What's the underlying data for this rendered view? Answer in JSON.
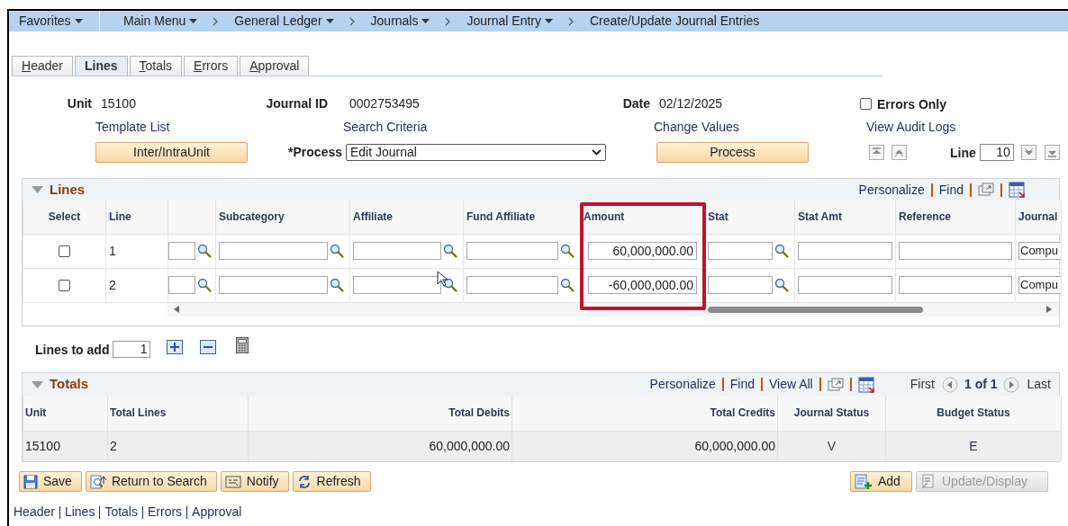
{
  "nav": [
    {
      "label": "Favorites",
      "kind": "menu",
      "dropdown": true
    },
    {
      "label": "Main Menu",
      "kind": "menu",
      "dropdown": true
    },
    {
      "label": "General Ledger",
      "kind": "crumb",
      "dropdown": true
    },
    {
      "label": "Journals",
      "kind": "crumb",
      "dropdown": true
    },
    {
      "label": "Journal Entry",
      "kind": "crumb",
      "dropdown": true
    },
    {
      "label": "Create/Update Journal Entries",
      "kind": "crumb",
      "dropdown": false
    }
  ],
  "tabs": [
    {
      "label": "Header",
      "selected": false
    },
    {
      "label": "Lines",
      "selected": true
    },
    {
      "label": "Totals",
      "selected": false
    },
    {
      "label": "Errors",
      "selected": false
    },
    {
      "label": "Approval",
      "selected": false
    }
  ],
  "header": {
    "unit_label": "Unit",
    "unit": "15100",
    "journal_id_label": "Journal ID",
    "journal_id": "0002753495",
    "date_label": "Date",
    "date": "02/12/2025",
    "errors_only": {
      "label": "Errors Only",
      "checked": false
    },
    "links": [
      "Template List",
      "Search Criteria",
      "Change Values",
      "View Audit Logs"
    ],
    "inter_button": "Inter/IntraUnit",
    "process_label": "*Process",
    "process_value": "Edit Journal",
    "process_button": "Process",
    "line_label": "Line",
    "line_value": "10"
  },
  "lines": {
    "title": "Lines",
    "toolbar": [
      "Personalize",
      "Find"
    ],
    "columns": [
      {
        "label": "Select",
        "kind": "select",
        "highlighted": false
      },
      {
        "label": "Line",
        "kind": "line",
        "highlighted": false
      },
      {
        "kind": "lookup",
        "highlighted": false
      },
      {
        "label": "Subcategory",
        "kind": "lookup",
        "highlighted": false
      },
      {
        "label": "Affiliate",
        "kind": "lookup",
        "highlighted": false
      },
      {
        "label": "Fund Affiliate",
        "kind": "lookup",
        "highlighted": false
      },
      {
        "label": "Amount",
        "kind": "amount",
        "highlighted": true
      },
      {
        "label": "Stat",
        "kind": "lookup",
        "highlighted": false
      },
      {
        "label": "Stat Amt",
        "kind": "input",
        "highlighted": false
      },
      {
        "label": "Reference",
        "kind": "input",
        "highlighted": false
      },
      {
        "label": "Journal",
        "kind": "journal",
        "highlighted": false
      }
    ],
    "rows": [
      {
        "selected": false,
        "line": "1",
        "amount": "60,000,000.00",
        "journal": "Compu"
      },
      {
        "selected": false,
        "line": "2",
        "amount": "-60,000,000.00",
        "journal": "Compu"
      }
    ]
  },
  "lines_to_add": {
    "label": "Lines to add",
    "value": "1"
  },
  "totals": {
    "title": "Totals",
    "toolbar": [
      "Personalize",
      "Find",
      "View All"
    ],
    "pager": {
      "first": "First",
      "range": "1 of 1",
      "last": "Last"
    },
    "columns": [
      "Unit",
      "Total Lines",
      "Total Debits",
      "Total Credits",
      "Journal Status",
      "Budget Status"
    ],
    "rows": [
      [
        "15100",
        "2",
        "60,000,000.00",
        "60,000,000.00",
        "V",
        "E"
      ]
    ]
  },
  "buttons": [
    {
      "label": "Save",
      "kind": "save",
      "disabled": false
    },
    {
      "label": "Return to Search",
      "kind": "return",
      "disabled": false
    },
    {
      "label": "Notify",
      "kind": "notify",
      "disabled": false
    },
    {
      "label": "Refresh",
      "kind": "refresh",
      "disabled": false
    }
  ],
  "right_buttons": [
    {
      "label": "Add",
      "kind": "add",
      "disabled": false
    },
    {
      "label": "Update/Display",
      "kind": "update",
      "disabled": true
    }
  ],
  "footer_links": [
    "Header",
    "Lines",
    "Totals",
    "Errors",
    "Approval"
  ]
}
